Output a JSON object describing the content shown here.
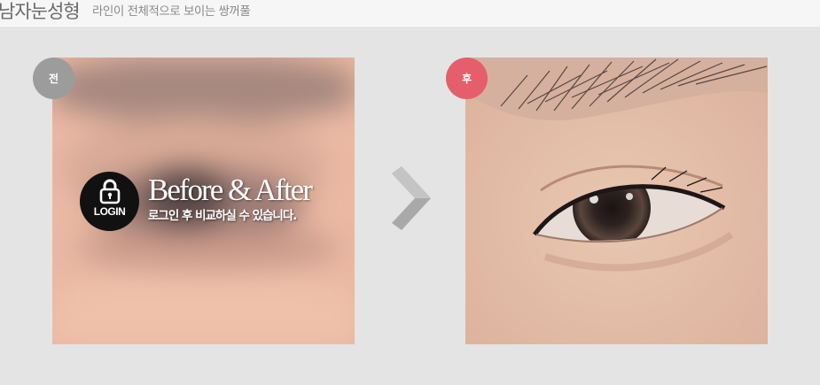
{
  "header": {
    "title": "남자눈성형",
    "subtitle": "라인이 전체적으로 보이는 쌍꺼풀"
  },
  "before": {
    "badge": "전",
    "login_icon_label": "LOGIN",
    "overlay_title": "Before & After",
    "overlay_subtitle": "로그인 후 비교하실 수 있습니다."
  },
  "after": {
    "badge": "후"
  },
  "colors": {
    "header_bg": "#f6f6f6",
    "page_bg": "#e4e4e4",
    "badge_before": "#9c9c9c",
    "badge_after": "#e45e6b",
    "arrow": "#a3a3a3"
  },
  "icons": [
    "lock-icon",
    "chevron-right-icon"
  ]
}
